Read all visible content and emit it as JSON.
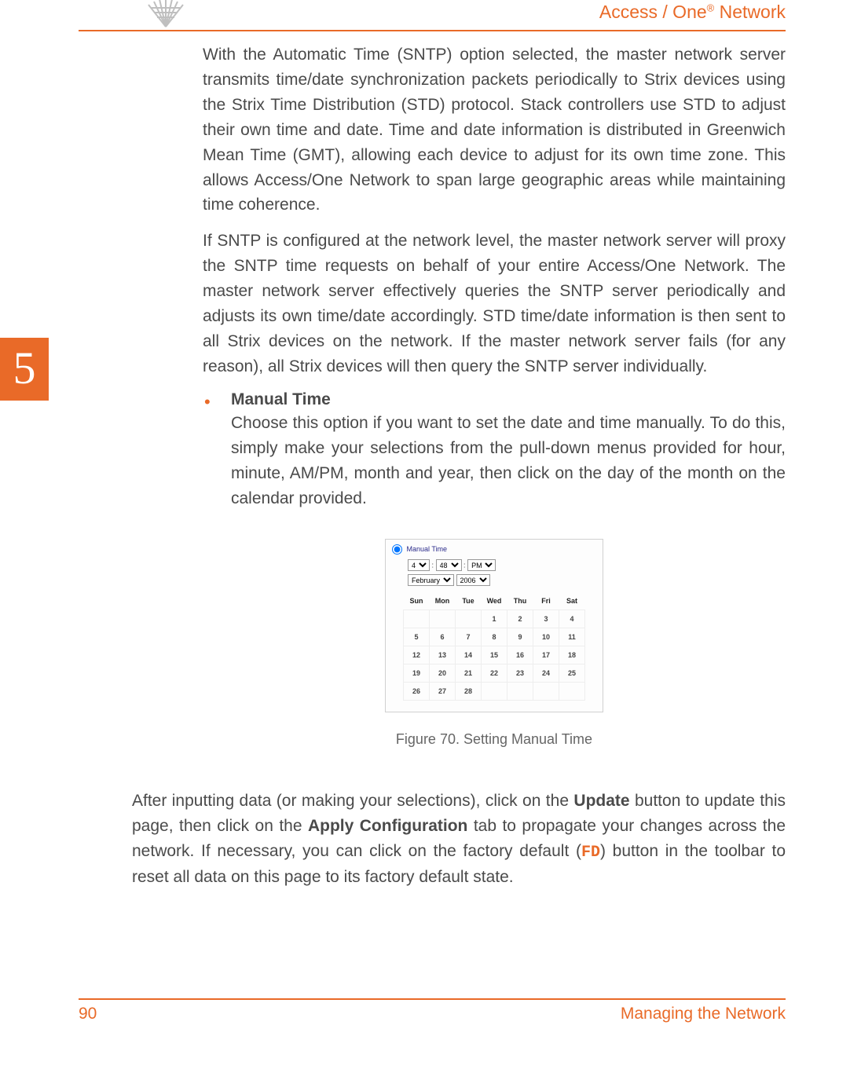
{
  "header": {
    "title_prefix": "Access / One",
    "title_suffix": " Network",
    "registered": "®"
  },
  "chapter": {
    "number": "5"
  },
  "content": {
    "para1": "With the Automatic Time (SNTP) option selected, the master network server transmits time/date synchronization packets periodically to Strix devices using the Strix Time Distribution (STD) protocol. Stack controllers use STD to adjust their own time and date. Time and date information is distributed in Greenwich Mean Time (GMT), allowing each device to adjust for its own time zone. This allows Access/One Network to span large geographic areas while maintaining time coherence.",
    "para2": "If SNTP is configured at the network level, the master network server will proxy the SNTP time requests on behalf of your entire Access/One Network. The master network server effectively queries the SNTP server periodically and adjusts its own time/date accordingly. STD time/date information is then sent to all Strix devices on the network. If the master network server fails (for any reason), all Strix devices will then query the SNTP server individually.",
    "bullet": {
      "title": "Manual Time",
      "body": "Choose this option if you want to set the date and time manually. To do this, simply make your selections from the pull-down menus provided for hour, minute, AM/PM, month and year, then click on the day of the month on the calendar provided."
    },
    "after1_a": "After inputting data (or making your selections), click on the ",
    "after1_update": "Update",
    "after1_b": " button to update this page, then click on the ",
    "after1_apply": "Apply Configuration",
    "after1_c": " tab to propagate your changes across the network. If necessary, you can click on the factory default (",
    "after1_fd": "FD",
    "after1_d": ") button in the toolbar to reset all data on this page to its factory default state."
  },
  "figure": {
    "caption": "Figure 70. Setting Manual Time",
    "radio_label": "Manual Time",
    "hour": "4",
    "minute": "48",
    "ampm": "PM",
    "month": "February",
    "year": "2006",
    "days": [
      "Sun",
      "Mon",
      "Tue",
      "Wed",
      "Thu",
      "Fri",
      "Sat"
    ],
    "weeks": [
      [
        "",
        "",
        "",
        "1",
        "2",
        "3",
        "4"
      ],
      [
        "5",
        "6",
        "7",
        "8",
        "9",
        "10",
        "11"
      ],
      [
        "12",
        "13",
        "14",
        "15",
        "16",
        "17",
        "18"
      ],
      [
        "19",
        "20",
        "21",
        "22",
        "23",
        "24",
        "25"
      ],
      [
        "26",
        "27",
        "28",
        "",
        "",
        "",
        ""
      ]
    ]
  },
  "footer": {
    "page": "90",
    "section": "Managing the Network"
  }
}
